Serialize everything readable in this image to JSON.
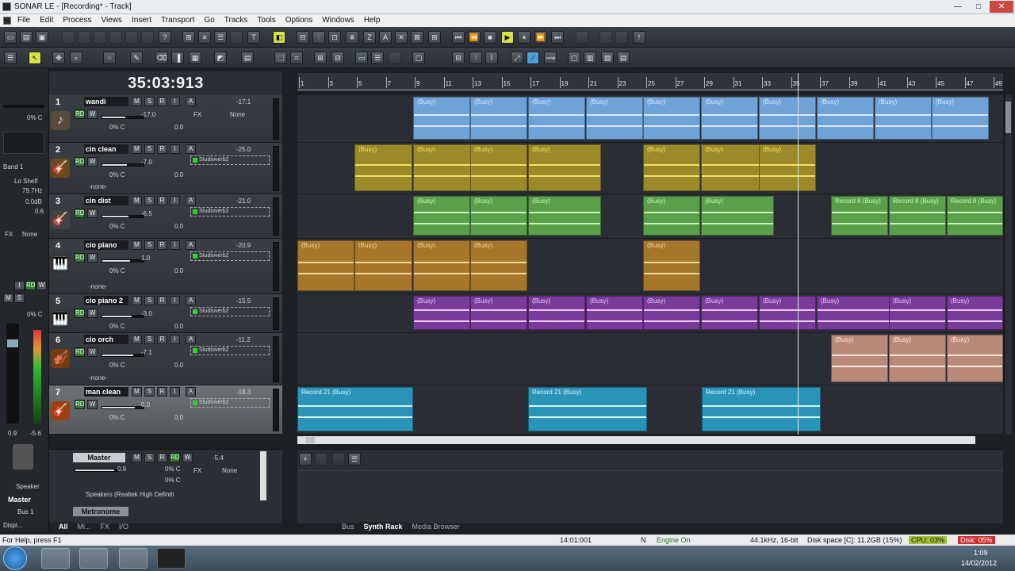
{
  "window": {
    "title": "SONAR LE - [Recording* - Track]",
    "minimize": "—",
    "maximize": "□",
    "close": "✕"
  },
  "menu": [
    "File",
    "Edit",
    "Process",
    "Views",
    "Insert",
    "Transport",
    "Go",
    "Tracks",
    "Tools",
    "Options",
    "Windows",
    "Help"
  ],
  "clock": "35:03:913",
  "ruler": [
    "1",
    "3",
    "5",
    "7",
    "9",
    "11",
    "13",
    "15",
    "17",
    "19",
    "21",
    "23",
    "25",
    "27",
    "29",
    "31",
    "33",
    "35",
    "37",
    "39",
    "41",
    "43",
    "45",
    "47",
    "49"
  ],
  "inspector": {
    "band": "Band 1",
    "shelf": "Lo Shelf",
    "freq": "79.7Hz",
    "gain": "0.0dB",
    "q": "0.6",
    "fx": "FX",
    "fx_value": "None",
    "pan": "0% C",
    "meter_l": "0.9",
    "meter_r": "-5.6",
    "out1": "Speaker",
    "out2": "Master",
    "out3": "Bus 1",
    "disp": "Displ..."
  },
  "tracks": [
    {
      "num": "1",
      "name": "wandi",
      "vol": "-17.0",
      "pan": "0% C",
      "gain": "0.0",
      "fx": "FX",
      "fx_value": "None",
      "peak": "-17.1",
      "icon": "♪",
      "iconbg": "#5a4a3a"
    },
    {
      "num": "2",
      "name": "cin clean",
      "vol": "-7.0",
      "pan": "0% C",
      "gain": "0.0",
      "fx_plugin": "Studioverb2",
      "input": "-none-",
      "peak": "-25.0",
      "icon": "🎸",
      "iconbg": "#6a4a20"
    },
    {
      "num": "3",
      "name": "cin dist",
      "vol": "-6.5",
      "pan": "0% C",
      "gain": "0.0",
      "fx_plugin": "Studioverb2",
      "peak": "-21.0",
      "icon": "🎸",
      "iconbg": "#444"
    },
    {
      "num": "4",
      "name": "cio piano",
      "vol": "1.0",
      "pan": "0% C",
      "gain": "0.0",
      "fx_plugin": "Studioverb2",
      "input": "-none-",
      "peak": "-20.9",
      "icon": "🎹",
      "iconbg": "#333"
    },
    {
      "num": "5",
      "name": "cio piano 2",
      "vol": "-3.0",
      "pan": "0% C",
      "gain": "0.0",
      "fx_plugin": "Studioverb2",
      "peak": "-15.5",
      "icon": "🎹",
      "iconbg": "#333"
    },
    {
      "num": "6",
      "name": "cio orch",
      "vol": "-7.1",
      "pan": "0% C",
      "gain": "0.0",
      "fx_plugin": "Studioverb2",
      "input": "-none-",
      "peak": "-11.2",
      "icon": "🎻",
      "iconbg": "#7a3a10"
    },
    {
      "num": "7",
      "name": "man clean",
      "vol": "0.0",
      "pan": "0% C",
      "gain": "0.0",
      "fx_plugin": "Studioverb2",
      "peak": "-18.3",
      "icon": "🎸",
      "iconbg": "#a04010"
    }
  ],
  "track_buttons": {
    "m": "M",
    "s": "S",
    "r": "R",
    "i": "I",
    "a": "A",
    "rd": "RD",
    "w": "W"
  },
  "clip_label": "(Busy)",
  "record8": "Record 8 (Busy)",
  "record21": "Record 21 (Busy)",
  "bus": {
    "name": "Master",
    "vol": "0.9",
    "pan1": "0% C",
    "pan2": "0% C",
    "fx": "FX",
    "fx_value": "None",
    "peak": "-5.4",
    "output": "Speakers (Realtek High Definiti",
    "metronome": "Metronome"
  },
  "bus_tabs": [
    "All",
    "Mi...",
    "FX",
    "I/O"
  ],
  "synth_tabs": [
    "Bus",
    "Synth Rack",
    "Media Browser"
  ],
  "status": {
    "help": "For Help, press F1",
    "time": "14:01:001",
    "mode": "N",
    "engine": "Engine On",
    "format": "44.1kHz, 16-bit",
    "disk": "Disk space [C]: 11.2GB (15%)",
    "cpu": "CPU: 03%",
    "disk_meter": "Disk: 05%"
  },
  "taskbar": {
    "time": "1:09",
    "date": "14/02/2012"
  },
  "colors": {
    "t1": "#6fa3d8",
    "t2": "#9c8a2a",
    "t3": "#5aa04a",
    "t4": "#a6762a",
    "t5": "#7a3a9a",
    "t6": "#b98a7a",
    "t7": "#2a94b8"
  }
}
